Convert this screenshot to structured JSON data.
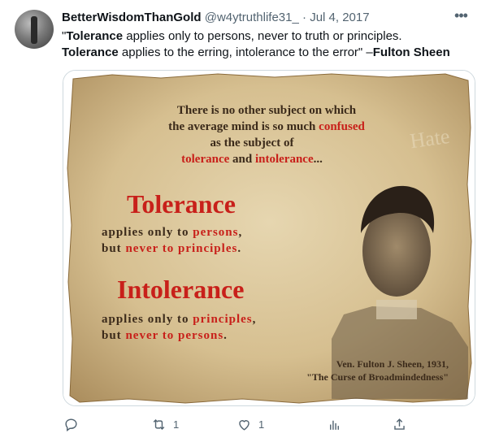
{
  "tweet": {
    "author": {
      "display_name": "BetterWisdomThanGold",
      "handle": "@w4ytruthlife31_",
      "separator": " · ",
      "date": "Jul 4, 2017"
    },
    "text": {
      "quote_open": "\"",
      "word1": "Tolerance",
      "line1_rest": " applies only to persons, never to truth or principles.",
      "word2": "Tolerance",
      "line2_rest": " applies to the erring, intolerance to the error\" –",
      "attribution": "Fulton Sheen"
    }
  },
  "image": {
    "line1": "There is no other subject on which",
    "line2a": "the average mind is so much ",
    "line2b": "confused",
    "line3": "as the subject of",
    "line4a": "tolerance",
    "line4b": " and ",
    "line4c": "intolerance",
    "line4d": "...",
    "heading1": "Tolerance",
    "t1_line1a": "applies only to ",
    "t1_line1b": "persons",
    "t1_line1c": ",",
    "t1_line2a": "but ",
    "t1_line2b": "never to principles",
    "t1_line2c": ".",
    "heading2": "Intolerance",
    "t2_line1a": "applies only to ",
    "t2_line1b": "principles",
    "t2_line1c": ",",
    "t2_line2a": "but ",
    "t2_line2b": "never to persons",
    "t2_line2c": ".",
    "watermark": "Hate",
    "credit1": "Ven. Fulton J. Sheen, 1931,",
    "credit2": "\"The Curse of Broadmindedness\"",
    "colors": {
      "parchment": "#d8c49a",
      "red": "#c8201a",
      "ink": "#3b2a1a"
    }
  },
  "actions": {
    "reply_icon": "reply-icon",
    "retweet_icon": "retweet-icon",
    "retweet_count": "1",
    "like_icon": "heart-icon",
    "like_count": "1",
    "views_icon": "analytics-icon",
    "share_icon": "share-icon"
  }
}
